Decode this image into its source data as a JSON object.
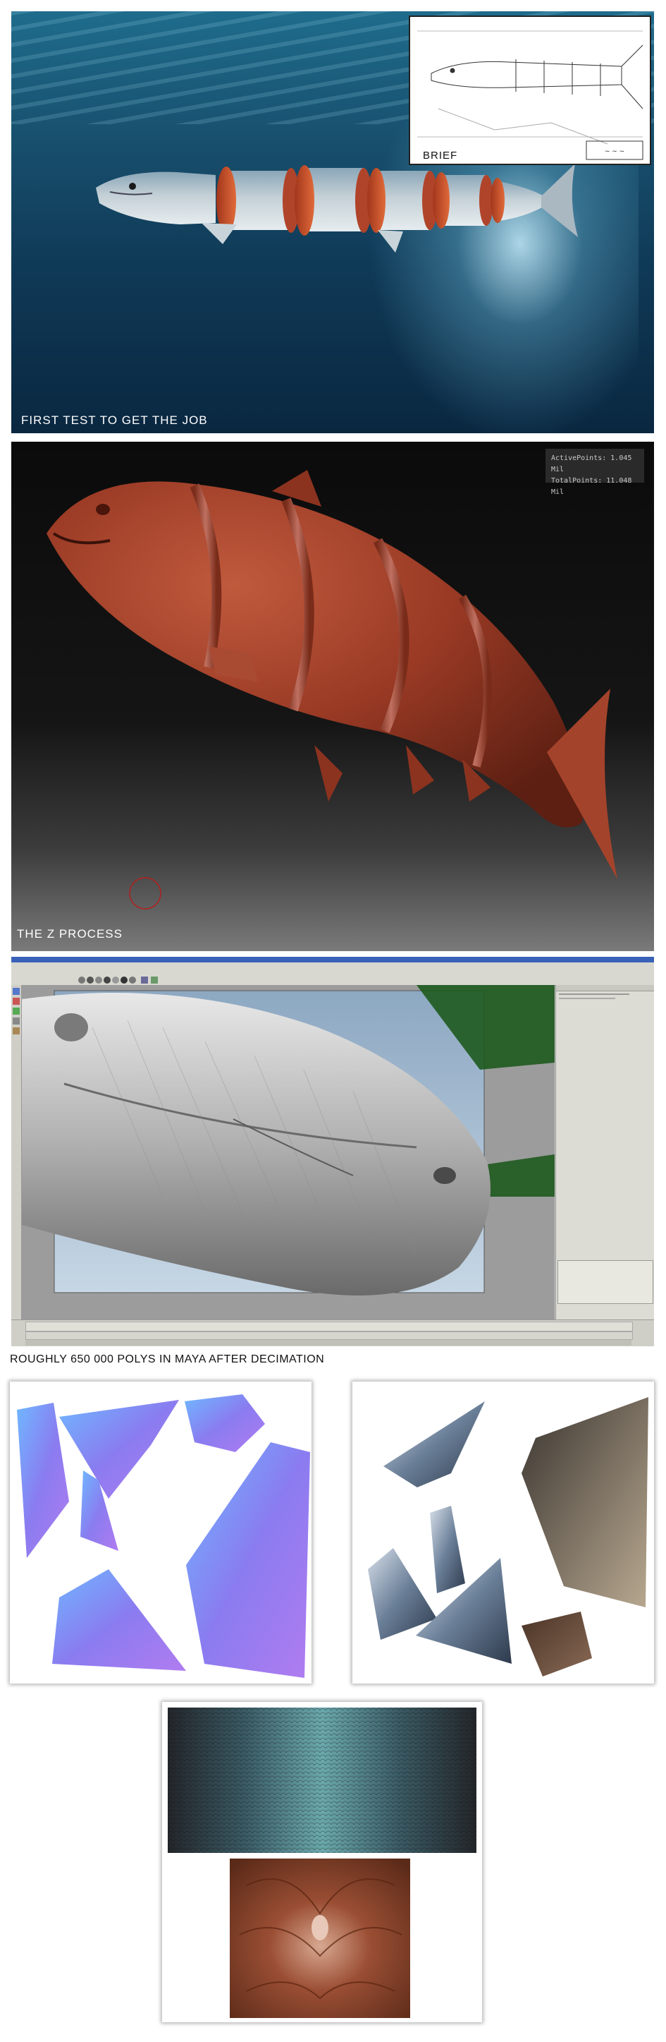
{
  "panel_1": {
    "caption": "FIRST TEST TO GET THE JOB",
    "brief_label": "BRIEF"
  },
  "panel_2": {
    "caption": "THE Z PROCESS",
    "stats": {
      "active_points": "ActivePoints: 1.045 Mil",
      "total_points": "TotalPoints: 11.048 Mil"
    }
  },
  "panel_3": {
    "caption": "ROUGHLY 650 000 POLYS IN MAYA AFTER DECIMATION"
  },
  "colors": {
    "water_deep": "#0a2740",
    "water_light": "#1f6c8c",
    "salmon_clay": "#9a3a25",
    "cut_orange": "#c8502a",
    "normal_map_purple": "#8a7cf0",
    "normal_map_blue": "#6fb7ff",
    "maya_ui": "#c9c9c9",
    "maya_green_plane": "#1e5a1e"
  },
  "icons": [
    "fish-illustration",
    "zbrush-sculpt",
    "maya-viewport",
    "normal-map",
    "fin-textures",
    "skin-texture",
    "meat-texture"
  ]
}
